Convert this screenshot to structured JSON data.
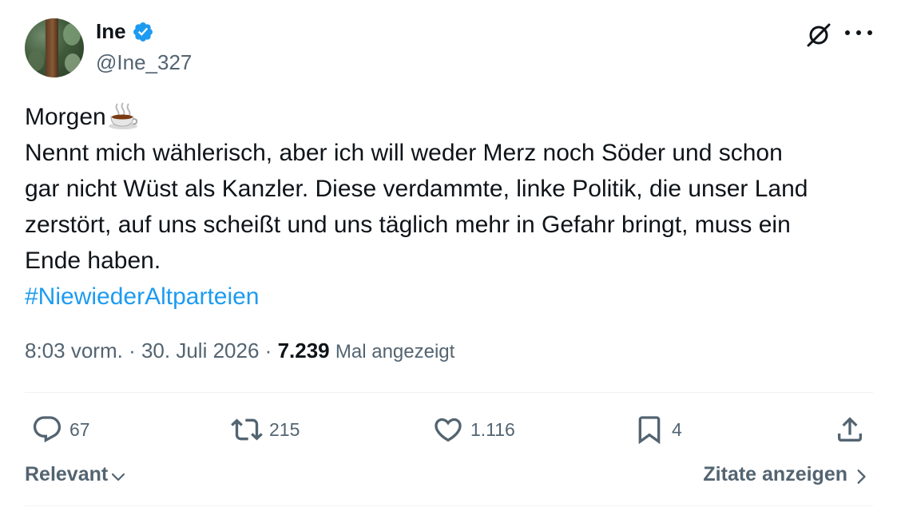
{
  "author": {
    "display_name": "Ine",
    "handle": "@Ine_327",
    "verified": true
  },
  "tweet": {
    "lines": [
      "Morgen",
      "Nennt mich wählerisch, aber ich will weder Merz noch Söder und schon",
      "gar nicht Wüst als Kanzler. Diese verdammte, linke Politik, die unser Land",
      "zerstört, auf uns scheißt und uns täglich mehr in Gefahr bringt, muss ein",
      "Ende haben."
    ],
    "hashtag": "#NiewiederAltparteien",
    "emoji_icon": "hot-beverage-icon"
  },
  "meta": {
    "time": "8:03 vorm.",
    "separator": "·",
    "date": "30. Juli 2026",
    "views_count": "7.239",
    "views_label": "Mal angezeigt"
  },
  "actions": {
    "replies": "67",
    "reposts": "215",
    "likes": "1.116",
    "bookmarks": "4"
  },
  "footer": {
    "sort_label": "Relevant",
    "quotes_label": "Zitate anzeigen"
  },
  "colors": {
    "text": "#0f1419",
    "secondary": "#536471",
    "accent": "#1d9bf0",
    "divider": "#eff3f4"
  },
  "icons": [
    "verified-badge-icon",
    "grok-icon",
    "more-icon",
    "reply-icon",
    "repost-icon",
    "like-icon",
    "bookmark-icon",
    "share-icon",
    "chevron-down-icon",
    "chevron-right-icon"
  ]
}
